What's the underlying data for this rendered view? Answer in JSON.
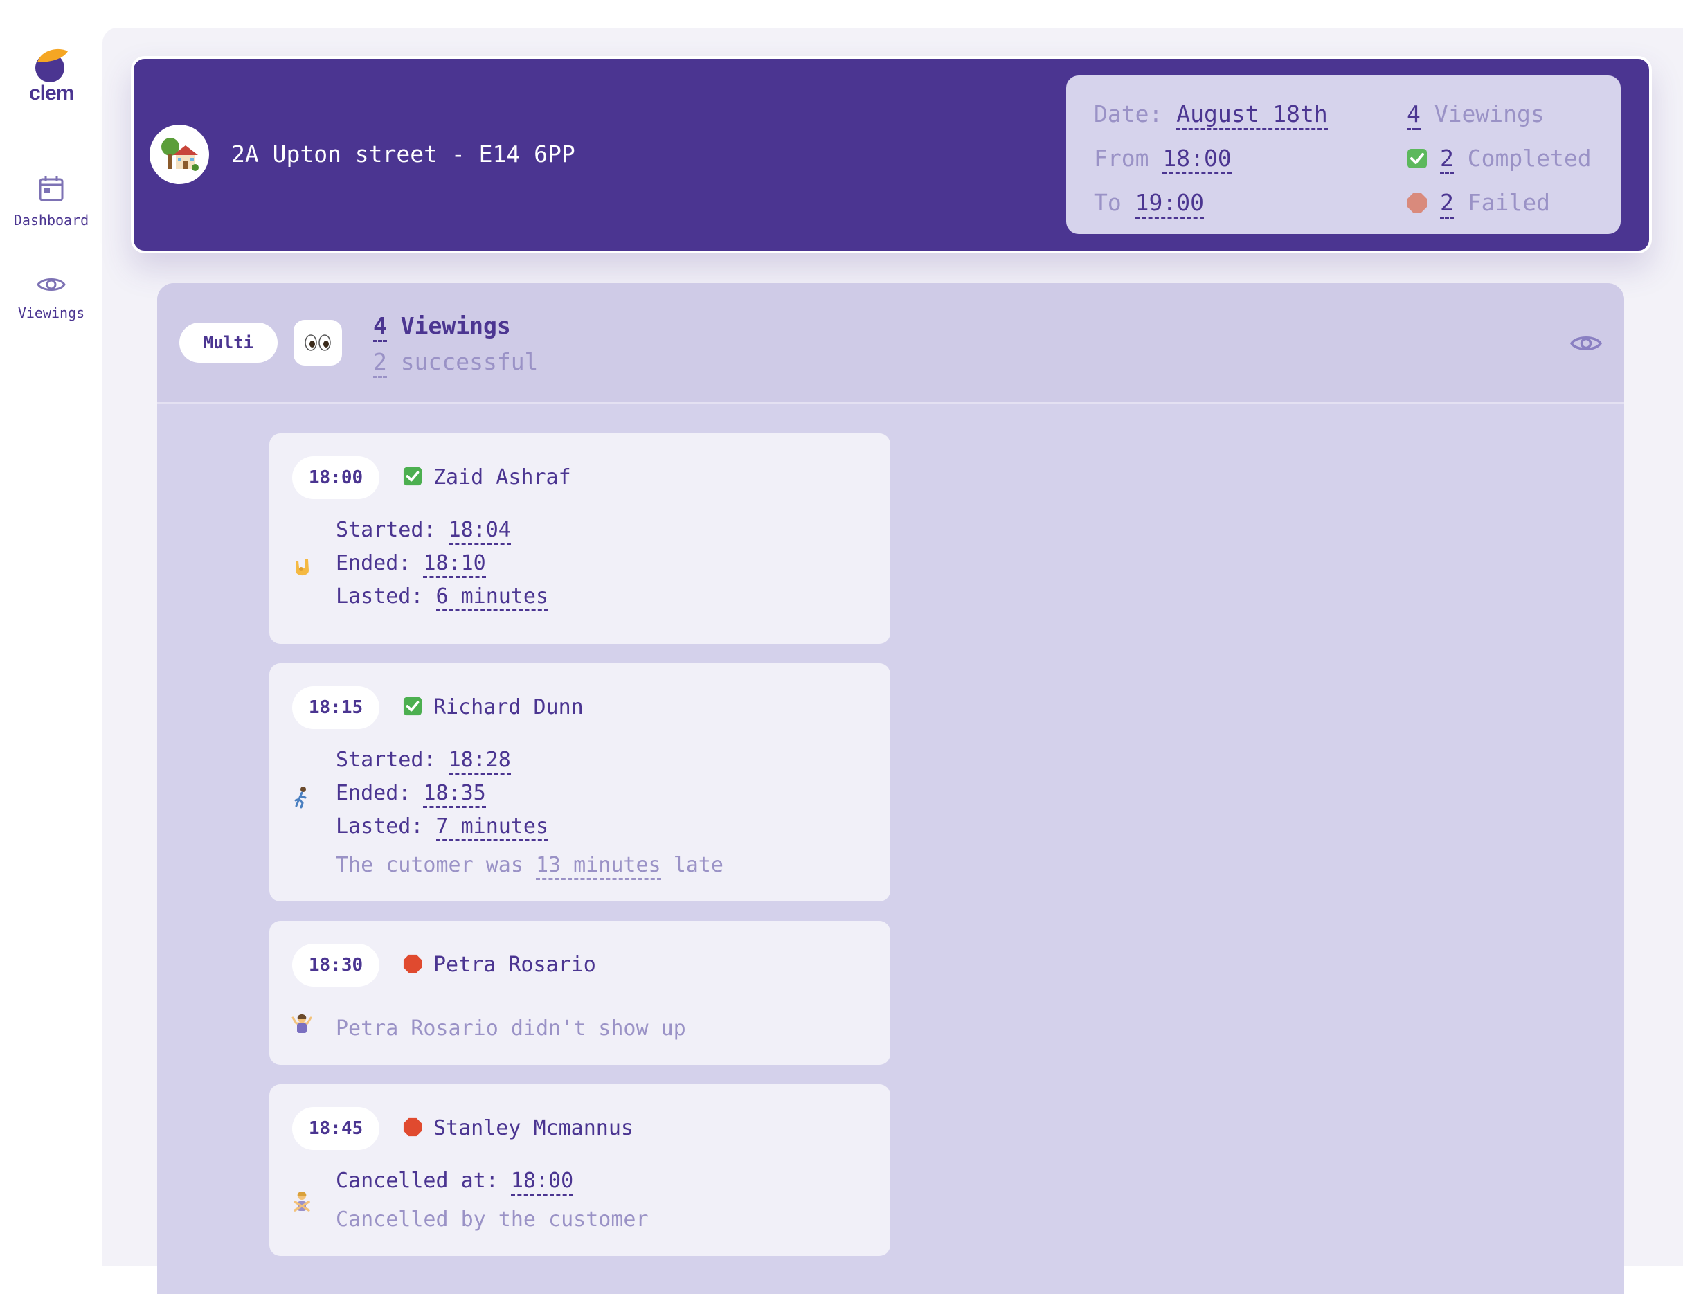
{
  "sidebar": {
    "logo_text": "clem",
    "items": [
      {
        "label": "Dashboard",
        "icon": "calendar-icon"
      },
      {
        "label": "Viewings",
        "icon": "eye-icon"
      }
    ]
  },
  "header": {
    "address": "2A Upton street - E14 6PP",
    "date_label": "Date:",
    "date_value": "August 18th",
    "from_label": "From",
    "from_value": "18:00",
    "to_label": "To",
    "to_value": "19:00",
    "viewings_count": "4",
    "viewings_label": "Viewings",
    "completed_count": "2",
    "completed_label": "Completed",
    "failed_count": "2",
    "failed_label": "Failed"
  },
  "panel": {
    "type_label": "Multi",
    "count": "4",
    "count_label": "Viewings",
    "successful_count": "2",
    "successful_label": "successful"
  },
  "viewings": [
    {
      "time": "18:00",
      "name": "Zaid Ashraf",
      "status": "completed",
      "started_label": "Started:",
      "started": "18:04",
      "ended_label": "Ended:",
      "ended": "18:10",
      "lasted_label": "Lasted:",
      "lasted": "6 minutes"
    },
    {
      "time": "18:15",
      "name": "Richard Dunn",
      "status": "completed",
      "started_label": "Started:",
      "started": "18:28",
      "ended_label": "Ended:",
      "ended": "18:35",
      "lasted_label": "Lasted:",
      "lasted": "7 minutes",
      "late_prefix": "The cutomer was",
      "late_value": "13 minutes",
      "late_suffix": "late"
    },
    {
      "time": "18:30",
      "name": "Petra Rosario",
      "status": "failed",
      "note": "Petra Rosario didn't show up"
    },
    {
      "time": "18:45",
      "name": "Stanley Mcmannus",
      "status": "failed",
      "cancelled_label": "Cancelled at:",
      "cancelled_at": "18:00",
      "note": "Cancelled by the customer"
    }
  ],
  "colors": {
    "brand": "#4b3591",
    "accent": "#f5a623",
    "muted": "#9a92c6",
    "panel": "#d4d1eb",
    "success": "#4caf50",
    "failed": "#e04a2f"
  }
}
